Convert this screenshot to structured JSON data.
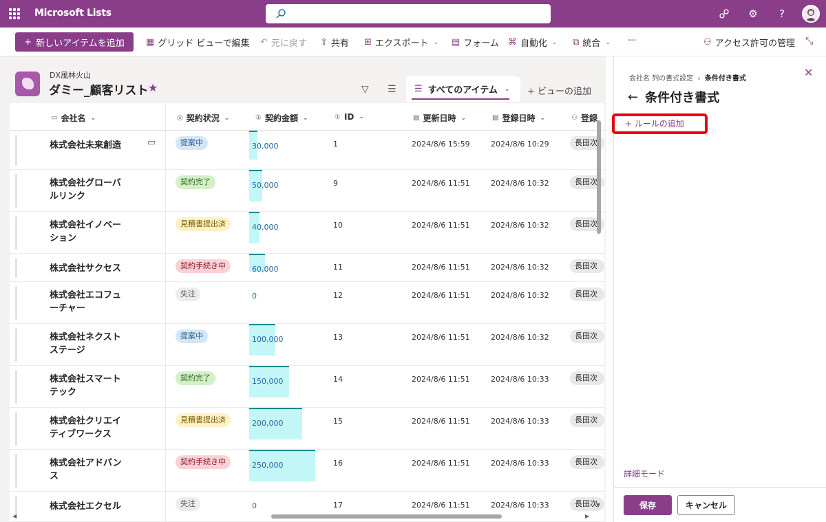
{
  "suite": {
    "app_name": "Microsoft Lists",
    "search_placeholder": ""
  },
  "command_bar": {
    "new_item": "新しいアイテムを追加",
    "grid_edit": "グリッド ビューで編集",
    "undo": "元に戻す",
    "share": "共有",
    "export": "エクスポート",
    "forms": "フォーム",
    "automate": "自動化",
    "integrate": "統合",
    "more": "···",
    "access": "アクセス許可の管理"
  },
  "list_header": {
    "site": "DX風林火山",
    "title": "ダミー_顧客リスト",
    "current_view": "すべてのアイテム",
    "add_view": "ビューの追加"
  },
  "columns": [
    "会社名",
    "契約状況",
    "契約金額",
    "ID",
    "更新日時",
    "登録日時",
    "登録"
  ],
  "rows": [
    {
      "name": "株式会社未来創造",
      "status": "提案中",
      "amount": "30,000",
      "amount_value": 30000,
      "id": "1",
      "updated": "2024/8/6 15:59",
      "created": "2024/8/6 10:29",
      "person": "長田次",
      "comment": true
    },
    {
      "name": "株式会社グローバルリンク",
      "status": "契約完了",
      "amount": "50,000",
      "amount_value": 50000,
      "id": "9",
      "updated": "2024/8/6 11:51",
      "created": "2024/8/6 10:32",
      "person": "長田次",
      "comment": false
    },
    {
      "name": "株式会社イノベーション",
      "status": "見積書提出済",
      "amount": "40,000",
      "amount_value": 40000,
      "id": "10",
      "updated": "2024/8/6 11:51",
      "created": "2024/8/6 10:32",
      "person": "長田次",
      "comment": false
    },
    {
      "name": "株式会社サクセス",
      "status": "契約手続き中",
      "amount": "60,000",
      "amount_value": 60000,
      "id": "11",
      "updated": "2024/8/6 11:51",
      "created": "2024/8/6 10:32",
      "person": "長田次",
      "comment": false
    },
    {
      "name": "株式会社エコフューチャー",
      "status": "失注",
      "amount": "0",
      "amount_value": 0,
      "id": "12",
      "updated": "2024/8/6 11:51",
      "created": "2024/8/6 10:32",
      "person": "長田次",
      "comment": false
    },
    {
      "name": "株式会社ネクストステージ",
      "status": "提案中",
      "amount": "100,000",
      "amount_value": 100000,
      "id": "13",
      "updated": "2024/8/6 11:51",
      "created": "2024/8/6 10:32",
      "person": "長田次",
      "comment": false
    },
    {
      "name": "株式会社スマートテック",
      "status": "契約完了",
      "amount": "150,000",
      "amount_value": 150000,
      "id": "14",
      "updated": "2024/8/6 11:51",
      "created": "2024/8/6 10:33",
      "person": "長田次",
      "comment": false
    },
    {
      "name": "株式会社クリエイティブワークス",
      "status": "見積書提出済",
      "amount": "200,000",
      "amount_value": 200000,
      "id": "15",
      "updated": "2024/8/6 11:51",
      "created": "2024/8/6 10:33",
      "person": "長田次",
      "comment": false
    },
    {
      "name": "株式会社アドバンス",
      "status": "契約手続き中",
      "amount": "250,000",
      "amount_value": 250000,
      "id": "16",
      "updated": "2024/8/6 11:51",
      "created": "2024/8/6 10:33",
      "person": "長田次",
      "comment": false
    },
    {
      "name": "株式会社エクセル",
      "status": "失注",
      "amount": "0",
      "amount_value": 0,
      "id": "17",
      "updated": "2024/8/6 11:51",
      "created": "2024/8/6 10:33",
      "person": "長田次",
      "comment": false
    }
  ],
  "status_colors": {
    "提案中": {
      "bg": "#d4e7f7",
      "fg": "#2c5e8a"
    },
    "契約完了": {
      "bg": "#d3f0c9",
      "fg": "#2f6b20"
    },
    "見積書提出済": {
      "bg": "#fdf1c9",
      "fg": "#7a5d00"
    },
    "契約手続き中": {
      "bg": "#f9d2d6",
      "fg": "#8a1c2a"
    },
    "失注": {
      "bg": "#ececec",
      "fg": "#555555"
    }
  },
  "panel": {
    "crumb_parent": "会社名 列の書式設定",
    "crumb_current": "条件付き書式",
    "title": "条件付き書式",
    "add_rule": "ルールの追加",
    "advanced_mode": "詳細モード",
    "save": "保存",
    "cancel": "キャンセル"
  },
  "icons": {
    "search": "search-icon",
    "back": "arrow-left-icon",
    "close": "close-icon",
    "star": "star-icon"
  },
  "accent_color": "#8a3e8a"
}
